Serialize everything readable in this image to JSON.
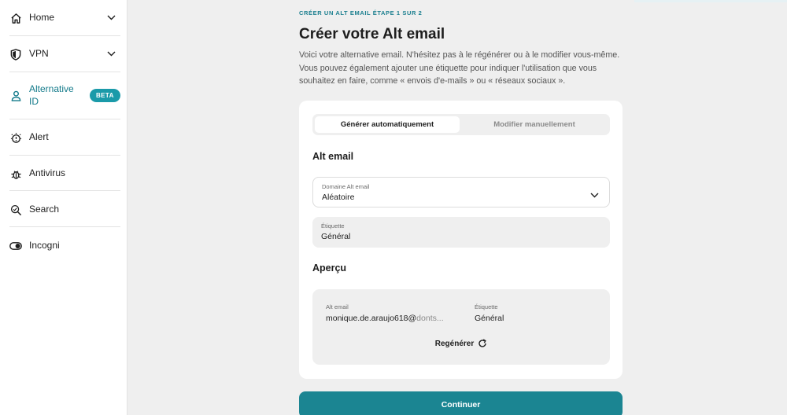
{
  "sidebar": {
    "items": [
      {
        "label": "Home",
        "icon": "home-icon",
        "expandable": true
      },
      {
        "label": "VPN",
        "icon": "shield-icon",
        "expandable": true
      },
      {
        "label": "Alternative ID",
        "icon": "user-icon",
        "badge": "BETA",
        "active": true
      },
      {
        "label": "Alert",
        "icon": "alert-icon"
      },
      {
        "label": "Antivirus",
        "icon": "bug-icon"
      },
      {
        "label": "Search",
        "icon": "search-icon"
      },
      {
        "label": "Incogni",
        "icon": "toggle-icon"
      }
    ]
  },
  "header": {
    "eyebrow": "CRÉER UN ALT EMAIL ÉTAPE 1 SUR 2",
    "title": "Créer votre Alt email",
    "description": "Voici votre alternative email. N'hésitez pas à le régénérer ou à le modifier vous-même. Vous pouvez également ajouter une étiquette pour indiquer l'utilisation que vous souhaitez en faire, comme « envois d'e-mails » ou « réseaux sociaux »."
  },
  "form": {
    "tabs": [
      {
        "label": "Générer automatiquement",
        "selected": true
      },
      {
        "label": "Modifier manuellement",
        "selected": false
      }
    ],
    "alt_email_section": "Alt email",
    "domain": {
      "label": "Domaine Alt email",
      "value": "Aléatoire"
    },
    "tag": {
      "label": "Étiquette",
      "value": "Général"
    },
    "preview_section": "Aperçu",
    "preview": {
      "email_label": "Alt email",
      "email_local": "monique.de.araujo618@",
      "email_domain": "donts...",
      "tag_label": "Étiquette",
      "tag_value": "Général",
      "regenerate": "Regénérer"
    }
  },
  "actions": {
    "continue": "Continuer"
  },
  "colors": {
    "accent": "#1b8592",
    "badge": "#1a9aa9",
    "active_text": "#137a8a",
    "background": "#efefef"
  }
}
